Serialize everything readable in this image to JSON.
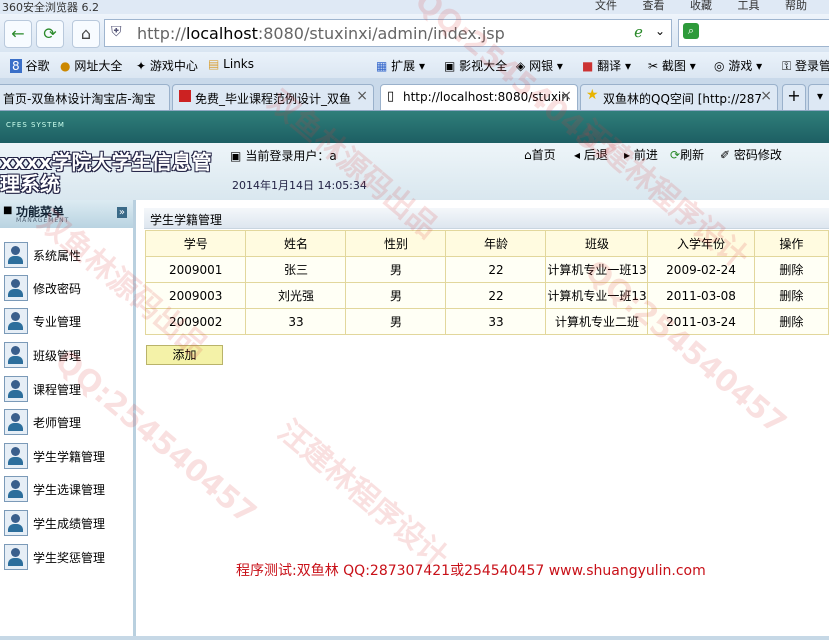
{
  "browser": {
    "title": "360安全浏览器 6.2",
    "menus": [
      "文件",
      "查看",
      "收藏",
      "工具",
      "帮助"
    ],
    "url_prefix": "http://",
    "url_host": "localhost",
    "url_rest": ":8080/stuxinxi/admin/index.jsp",
    "bookmarks_left": [
      "谷歌",
      "网址大全",
      "游戏中心",
      "Links"
    ],
    "bookmarks_right": [
      "扩展",
      "影视大全",
      "网银",
      "翻译",
      "截图",
      "游戏",
      "登录管"
    ],
    "tabs": [
      {
        "label": "首页-双鱼林设计淘宝店-淘宝",
        "active": false
      },
      {
        "label": "免费_毕业课程范例设计_双鱼",
        "active": false
      },
      {
        "label": "http://localhost:8080/stuxin",
        "active": true
      },
      {
        "label": "双鱼林的QQ空间 [http://287",
        "active": false
      }
    ]
  },
  "app": {
    "brand_small": "CFES SYSTEM",
    "title": "xxxx学院大学生信息管理系统",
    "current_user_label": "当前登录用户：a",
    "datetime": "2014年1月14日  14:05:34",
    "toolbar": [
      "首页",
      "后退",
      "前进",
      "刷新",
      "密码修改"
    ]
  },
  "sidebar": {
    "title": "功能菜单",
    "subtitle": "MANAGEMENT",
    "items": [
      "系统属性",
      "修改密码",
      "专业管理",
      "班级管理",
      "课程管理",
      "老师管理",
      "学生学籍管理",
      "学生选课管理",
      "学生成绩管理",
      "学生奖惩管理"
    ]
  },
  "main": {
    "panel_title": "学生学籍管理",
    "columns": [
      "学号",
      "姓名",
      "性别",
      "年龄",
      "班级",
      "入学年份",
      "操作"
    ],
    "rows": [
      [
        "2009001",
        "张三",
        "男",
        "22",
        "计算机专业一班13",
        "2009-02-24",
        "删除"
      ],
      [
        "2009003",
        "刘光强",
        "男",
        "22",
        "计算机专业一班13",
        "2011-03-08",
        "删除"
      ],
      [
        "2009002",
        "33",
        "男",
        "33",
        "计算机专业二班",
        "2011-03-24",
        "删除"
      ]
    ],
    "add_button": "添加",
    "footer": "程序测试:双鱼林 QQ:287307421或254540457 www.shuangyulin.com"
  },
  "watermarks": [
    "QQ:254540457",
    "双鱼林源码出品",
    "汪建林程序设计",
    "QQ:254540457",
    "双鱼林源码出品",
    "汪建林程序设计",
    "QQ:254540457"
  ],
  "colors": {
    "header_teal": "#1d5f63",
    "footer_red": "#c81018",
    "table_border": "#e2d79c"
  }
}
